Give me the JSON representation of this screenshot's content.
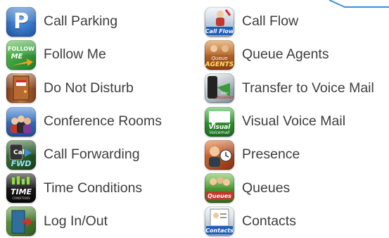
{
  "left_column": {
    "items": [
      {
        "label": "Call Parking",
        "icon": "call-parking-icon",
        "icon_text": "P",
        "color": "#2a6cc4"
      },
      {
        "label": "Follow Me",
        "icon": "follow-me-icon",
        "icon_text": "FOLLOW ME",
        "color": "#2f9a3c"
      },
      {
        "label": "Do Not Disturb",
        "icon": "do-not-disturb-icon",
        "icon_text": "",
        "color": "#a05a2c"
      },
      {
        "label": "Conference Rooms",
        "icon": "conference-rooms-icon",
        "icon_text": "",
        "color": "#2b5fa8"
      },
      {
        "label": "Call Forwarding",
        "icon": "call-forwarding-icon",
        "icon_text": "Call FWD",
        "color": "#3a8a3a"
      },
      {
        "label": "Time Conditions",
        "icon": "time-conditions-icon",
        "icon_text": "TIME",
        "color": "#1a1a1a"
      },
      {
        "label": "Log In/Out",
        "icon": "log-in-out-icon",
        "icon_text": "",
        "color": "#4a7a3a"
      }
    ]
  },
  "right_column": {
    "items": [
      {
        "label": "Call Flow",
        "icon": "call-flow-icon",
        "icon_text": "Call Flow",
        "color": "#2a6cc4"
      },
      {
        "label": "Queue Agents",
        "icon": "queue-agents-icon",
        "icon_text": "AGENTS",
        "color": "#c0642a"
      },
      {
        "label": "Transfer to Voice Mail",
        "icon": "transfer-voicemail-icon",
        "icon_text": "",
        "color": "#3a8a3a"
      },
      {
        "label": "Visual Voice Mail",
        "icon": "visual-voicemail-icon",
        "icon_text": "Visual",
        "color": "#2f8a3c"
      },
      {
        "label": "Presence",
        "icon": "presence-icon",
        "icon_text": "",
        "color": "#c65a2a"
      },
      {
        "label": "Queues",
        "icon": "queues-icon",
        "icon_text": "Queues",
        "color": "#3a8a2a"
      },
      {
        "label": "Contacts",
        "icon": "contacts-icon",
        "icon_text": "Contacts",
        "color": "#2a6cc4"
      }
    ]
  },
  "accent_color": "#3d8fd6"
}
